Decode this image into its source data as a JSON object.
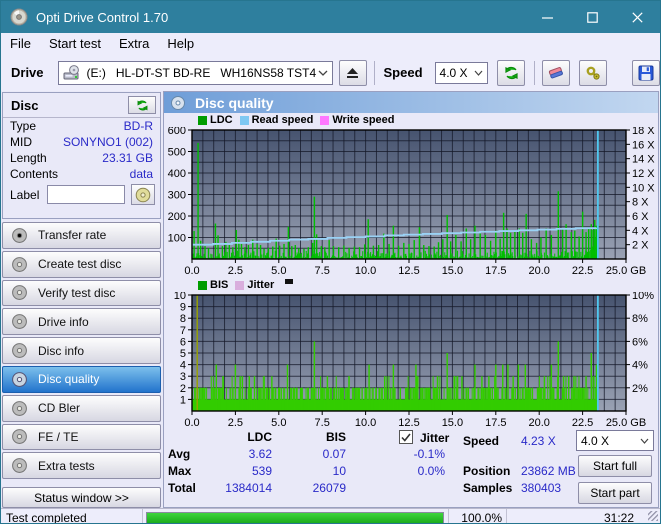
{
  "window": {
    "title": "Opti Drive Control 1.70"
  },
  "icons": {
    "app-icon": "cd-disc",
    "minimize-icon": "horizontal-line",
    "maximize-icon": "square",
    "close-icon": "x",
    "drive-icon": "disc-drive",
    "eject-icon": "triangle-over-bar",
    "refresh-icon": "green-circular-arrows",
    "eraser-icon": "pink-blue-eraser",
    "settings-icon": "yellow-wrench-gear",
    "save-icon": "blue-floppy-disk",
    "disc-button-icon": "gold-cd",
    "chevron-down-icon": "v",
    "check-icon": "checkmark"
  },
  "menu": {
    "items": [
      {
        "label": "File"
      },
      {
        "label": "Start test"
      },
      {
        "label": "Extra"
      },
      {
        "label": "Help"
      }
    ]
  },
  "toolbar": {
    "drive_label": "Drive",
    "drive_value": "(E:)   HL-DT-ST BD-RE   WH16NS58 TST4",
    "speed_label": "Speed",
    "speed_value": "4.0 X"
  },
  "sidebar": {
    "disc_panel": {
      "title": "Disc",
      "fields": [
        {
          "label": "Type",
          "value": "BD-R"
        },
        {
          "label": "MID",
          "value": "SONYNO1 (002)"
        },
        {
          "label": "Length",
          "value": "23.31 GB"
        },
        {
          "label": "Contents",
          "value": "data"
        }
      ],
      "label_field": {
        "label": "Label",
        "value": ""
      }
    },
    "nav": [
      {
        "label": "Transfer rate"
      },
      {
        "label": "Create test disc"
      },
      {
        "label": "Verify test disc"
      },
      {
        "label": "Drive info"
      },
      {
        "label": "Disc info"
      },
      {
        "label": "Disc quality"
      },
      {
        "label": "CD Bler"
      },
      {
        "label": "FE / TE"
      },
      {
        "label": "Extra tests"
      }
    ],
    "selected_nav": "Disc quality",
    "status_window_button": "Status window >>"
  },
  "content": {
    "header": "Disc quality"
  },
  "stats": {
    "col_headers": {
      "ldc": "LDC",
      "bis": "BIS",
      "jitter": "Jitter"
    },
    "jitter_checked": true,
    "row_labels": {
      "avg": "Avg",
      "max": "Max",
      "total": "Total"
    },
    "ldc": {
      "avg": "3.62",
      "max": "539",
      "total": "1384014"
    },
    "bis": {
      "avg": "0.07",
      "max": "10",
      "total": "26079"
    },
    "jitter": {
      "avg": "-0.1%",
      "max": "0.0%"
    },
    "right": {
      "speed_label": "Speed",
      "speed_value": "4.23 X",
      "position_label": "Position",
      "position_value": "23862 MB",
      "samples_label": "Samples",
      "samples_value": "380403"
    },
    "speed_select": "4.0 X",
    "start_full": "Start full",
    "start_part": "Start part"
  },
  "statusbar": {
    "status": "Test completed",
    "progress_value": 100,
    "progress_pct": "100.0%",
    "time": "31:22"
  },
  "colors": {
    "titlebar": "#2e7f9e",
    "selected_nav_top": "#7cc0ec",
    "selected_nav_bottom": "#2273cc",
    "value_blue": "#2a2ac8",
    "progress_green": "#22bb22",
    "plot_bg_top": "#46536f",
    "plot_bg_bottom": "#9aa2b4"
  },
  "chart_data": [
    {
      "type": "bar",
      "title": "LDC / Read speed / Write speed vs disc position",
      "legend": [
        {
          "label": "LDC",
          "color": "#009c00"
        },
        {
          "label": "Read speed",
          "color": "#7ec8f2"
        },
        {
          "label": "Write speed",
          "color": "#ff78ff"
        }
      ],
      "x_range": [
        0,
        25
      ],
      "x_ticks": [
        0.0,
        2.5,
        5.0,
        7.5,
        10.0,
        12.5,
        15.0,
        17.5,
        20.0,
        22.5,
        25.0
      ],
      "x_unit": "GB",
      "y_left": {
        "name": "LDC",
        "range": [
          0,
          600
        ],
        "ticks": [
          100,
          200,
          300,
          400,
          500,
          600
        ]
      },
      "y_right": {
        "name": "Read speed (X)",
        "range": [
          0,
          18
        ],
        "ticks": [
          2,
          4,
          6,
          8,
          10,
          12,
          14,
          16,
          18
        ],
        "suffix": " X"
      },
      "grid": {
        "x_divisions": 40,
        "y_divisions": 12
      },
      "data_end_x": 23.35,
      "end_line": {
        "x": 23.38,
        "color": "#4fc8f0"
      },
      "series": [
        {
          "name": "LDC",
          "type": "bar",
          "color": "#00be00",
          "baseline": {
            "step": 0.035,
            "seed": 42,
            "noise_max": 36,
            "end_ramp_start": 22.55,
            "end_ramp_max": 120
          },
          "spikes": [
            [
              0.12,
              130
            ],
            [
              0.35,
              540
            ],
            [
              0.5,
              85
            ],
            [
              0.75,
              60
            ],
            [
              0.95,
              50
            ],
            [
              1.35,
              165
            ],
            [
              1.5,
              110
            ],
            [
              1.75,
              60
            ],
            [
              1.95,
              80
            ],
            [
              2.15,
              65
            ],
            [
              2.35,
              55
            ],
            [
              2.55,
              135
            ],
            [
              2.7,
              90
            ],
            [
              2.85,
              70
            ],
            [
              3.05,
              55
            ],
            [
              3.25,
              65
            ],
            [
              3.5,
              90
            ],
            [
              3.75,
              70
            ],
            [
              3.95,
              65
            ],
            [
              4.15,
              48
            ],
            [
              4.4,
              52
            ],
            [
              4.65,
              58
            ],
            [
              4.85,
              95
            ],
            [
              5.05,
              62
            ],
            [
              5.3,
              70
            ],
            [
              5.55,
              150
            ],
            [
              5.75,
              60
            ],
            [
              5.95,
              65
            ],
            [
              6.15,
              50
            ],
            [
              6.45,
              48
            ],
            [
              6.7,
              55
            ],
            [
              6.95,
              75
            ],
            [
              7.05,
              290
            ],
            [
              7.18,
              115
            ],
            [
              7.45,
              60
            ],
            [
              7.65,
              55
            ],
            [
              7.9,
              88
            ],
            [
              8.15,
              60
            ],
            [
              8.45,
              55
            ],
            [
              8.75,
              62
            ],
            [
              9.05,
              52
            ],
            [
              9.35,
              58
            ],
            [
              9.65,
              55
            ],
            [
              9.95,
              68
            ],
            [
              10.15,
              185
            ],
            [
              10.45,
              62
            ],
            [
              10.75,
              65
            ],
            [
              11.05,
              118
            ],
            [
              11.35,
              70
            ],
            [
              11.6,
              155
            ],
            [
              11.9,
              62
            ],
            [
              12.2,
              75
            ],
            [
              12.5,
              70
            ],
            [
              12.8,
              88
            ],
            [
              13.1,
              148
            ],
            [
              13.35,
              65
            ],
            [
              13.65,
              60
            ],
            [
              13.95,
              58
            ],
            [
              14.2,
              78
            ],
            [
              14.45,
              92
            ],
            [
              14.7,
              205
            ],
            [
              14.9,
              82
            ],
            [
              15.2,
              112
            ],
            [
              15.5,
              82
            ],
            [
              15.8,
              142
            ],
            [
              16.05,
              92
            ],
            [
              16.3,
              155
            ],
            [
              16.6,
              122
            ],
            [
              16.9,
              112
            ],
            [
              17.2,
              85
            ],
            [
              17.5,
              132
            ],
            [
              17.75,
              95
            ],
            [
              17.95,
              215
            ],
            [
              18.15,
              142
            ],
            [
              18.35,
              122
            ],
            [
              18.6,
              132
            ],
            [
              18.85,
              142
            ],
            [
              19.05,
              122
            ],
            [
              19.25,
              210
            ],
            [
              19.55,
              92
            ],
            [
              19.85,
              75
            ],
            [
              20.1,
              100
            ],
            [
              20.4,
              142
            ],
            [
              20.7,
              112
            ],
            [
              21.1,
              315
            ],
            [
              21.35,
              142
            ],
            [
              21.55,
              162
            ],
            [
              21.85,
              125
            ],
            [
              22.05,
              132
            ],
            [
              22.3,
              105
            ],
            [
              22.5,
              220
            ],
            [
              22.7,
              125
            ],
            [
              22.85,
              145
            ],
            [
              23.0,
              162
            ],
            [
              23.1,
              135
            ],
            [
              23.2,
              182
            ],
            [
              23.3,
              155
            ]
          ]
        },
        {
          "name": "Read speed",
          "type": "step-line",
          "axis": "right",
          "color": "#9ad2f5",
          "points": [
            [
              0,
              2.0
            ],
            [
              1.2,
              2.1
            ],
            [
              2.3,
              2.25
            ],
            [
              3.4,
              2.4
            ],
            [
              4.5,
              2.55
            ],
            [
              5.6,
              2.7
            ],
            [
              6.7,
              2.8
            ],
            [
              7.8,
              2.95
            ],
            [
              8.9,
              3.05
            ],
            [
              10.0,
              3.15
            ],
            [
              11.1,
              3.3
            ],
            [
              12.2,
              3.4
            ],
            [
              13.3,
              3.5
            ],
            [
              14.4,
              3.6
            ],
            [
              15.5,
              3.7
            ],
            [
              16.6,
              3.8
            ],
            [
              17.7,
              3.9
            ],
            [
              18.8,
              4.0
            ],
            [
              19.9,
              4.1
            ],
            [
              21.0,
              4.2
            ],
            [
              22.1,
              4.3
            ],
            [
              23.3,
              4.35
            ]
          ]
        },
        {
          "name": "Write speed",
          "type": "line",
          "color": "#ff78ff",
          "points": []
        }
      ]
    },
    {
      "type": "bar",
      "title": "BIS / Jitter vs disc position",
      "legend": [
        {
          "label": "BIS",
          "color": "#009c00"
        },
        {
          "label": "Jitter",
          "color": "#d9aedd"
        }
      ],
      "x_range": [
        0,
        25
      ],
      "x_ticks": [
        0.0,
        2.5,
        5.0,
        7.5,
        10.0,
        12.5,
        15.0,
        17.5,
        20.0,
        22.5,
        25.0
      ],
      "x_unit": "GB",
      "y_left": {
        "name": "BIS",
        "range": [
          0,
          10
        ],
        "ticks": [
          1,
          2,
          3,
          4,
          5,
          6,
          7,
          8,
          9,
          10
        ]
      },
      "y_right": {
        "name": "Jitter (%)",
        "range": [
          0,
          10
        ],
        "ticks": [
          2,
          4,
          6,
          8,
          10
        ],
        "suffix": "%"
      },
      "grid": {
        "x_divisions": 40,
        "y_divisions": 10
      },
      "data_end_x": 23.35,
      "end_line": {
        "x": 23.38,
        "color": "#4fc8f0"
      },
      "series": [
        {
          "name": "BIS",
          "type": "bar",
          "color": "#33cc00",
          "baseline": {
            "step": 0.03,
            "seed": 7,
            "base": 1,
            "p2": 0.42,
            "p3": 0.05
          },
          "spikes": [
            [
              0.3,
              10,
              "#9aa300"
            ],
            [
              1.4,
              4
            ],
            [
              1.8,
              3
            ],
            [
              2.2,
              2
            ],
            [
              2.5,
              4
            ],
            [
              2.9,
              3
            ],
            [
              3.3,
              3
            ],
            [
              3.6,
              3
            ],
            [
              3.9,
              2
            ],
            [
              4.3,
              2
            ],
            [
              4.6,
              3
            ],
            [
              5.0,
              2
            ],
            [
              5.5,
              4
            ],
            [
              5.9,
              2
            ],
            [
              6.3,
              2
            ],
            [
              6.7,
              2
            ],
            [
              7.05,
              6
            ],
            [
              7.5,
              2
            ],
            [
              7.8,
              3
            ],
            [
              8.2,
              2
            ],
            [
              8.6,
              2
            ],
            [
              9.0,
              2
            ],
            [
              9.4,
              2
            ],
            [
              9.8,
              2
            ],
            [
              10.2,
              4
            ],
            [
              10.6,
              2
            ],
            [
              11.1,
              3
            ],
            [
              11.6,
              4
            ],
            [
              12.0,
              2
            ],
            [
              12.4,
              2
            ],
            [
              12.9,
              4
            ],
            [
              13.3,
              2
            ],
            [
              13.7,
              2
            ],
            [
              14.1,
              2
            ],
            [
              14.7,
              5
            ],
            [
              15.1,
              3
            ],
            [
              15.3,
              3
            ],
            [
              15.55,
              3
            ],
            [
              15.9,
              2
            ],
            [
              16.3,
              4
            ],
            [
              16.7,
              3
            ],
            [
              17.1,
              3
            ],
            [
              17.5,
              4
            ],
            [
              17.9,
              4
            ],
            [
              18.2,
              4
            ],
            [
              18.5,
              3
            ],
            [
              18.8,
              4
            ],
            [
              19.2,
              4
            ],
            [
              19.6,
              2
            ],
            [
              20.0,
              2
            ],
            [
              20.3,
              3
            ],
            [
              20.7,
              4
            ],
            [
              21.1,
              6
            ],
            [
              21.4,
              3
            ],
            [
              21.7,
              3
            ],
            [
              22.0,
              3
            ],
            [
              22.4,
              2
            ],
            [
              22.7,
              3
            ],
            [
              23.0,
              5
            ],
            [
              23.15,
              3
            ],
            [
              23.3,
              4
            ]
          ]
        },
        {
          "name": "Jitter",
          "type": "line",
          "color": "#d9aedd",
          "points": []
        }
      ]
    }
  ]
}
